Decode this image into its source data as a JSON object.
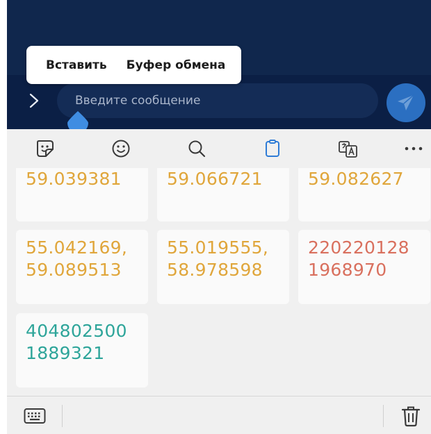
{
  "context_menu": {
    "paste_label": "Вставить",
    "clipboard_label": "Буфер обмена"
  },
  "input_bar": {
    "placeholder": "Введите сообщение"
  },
  "toolbar": {
    "icons": [
      "sticker-icon",
      "emoji-icon",
      "search-icon",
      "clipboard-icon",
      "translate-icon",
      "more-icon"
    ],
    "active": "clipboard-icon",
    "active_color": "#2f7cd6"
  },
  "clipboard_items": [
    {
      "text": "59.039381",
      "color": "#e0a63b"
    },
    {
      "text": "59.066721",
      "color": "#e0a63b"
    },
    {
      "text": "59.082627",
      "color": "#e0a63b"
    },
    {
      "text": "55.042169, 59.089513",
      "color": "#e0a63b"
    },
    {
      "text": "55.019555, 58.978598",
      "color": "#e0a63b"
    },
    {
      "text": "2202201281968970",
      "color": "#d9705e"
    },
    {
      "text": "4048025001889321",
      "color": "#2ea59a"
    }
  ],
  "bottom_bar": {
    "icons": [
      "keyboard-icon",
      "trash-icon"
    ]
  },
  "colors": {
    "chat_background": "#10274d",
    "send_button": "#2b6fc1",
    "panel_background": "#f0f0f0"
  }
}
